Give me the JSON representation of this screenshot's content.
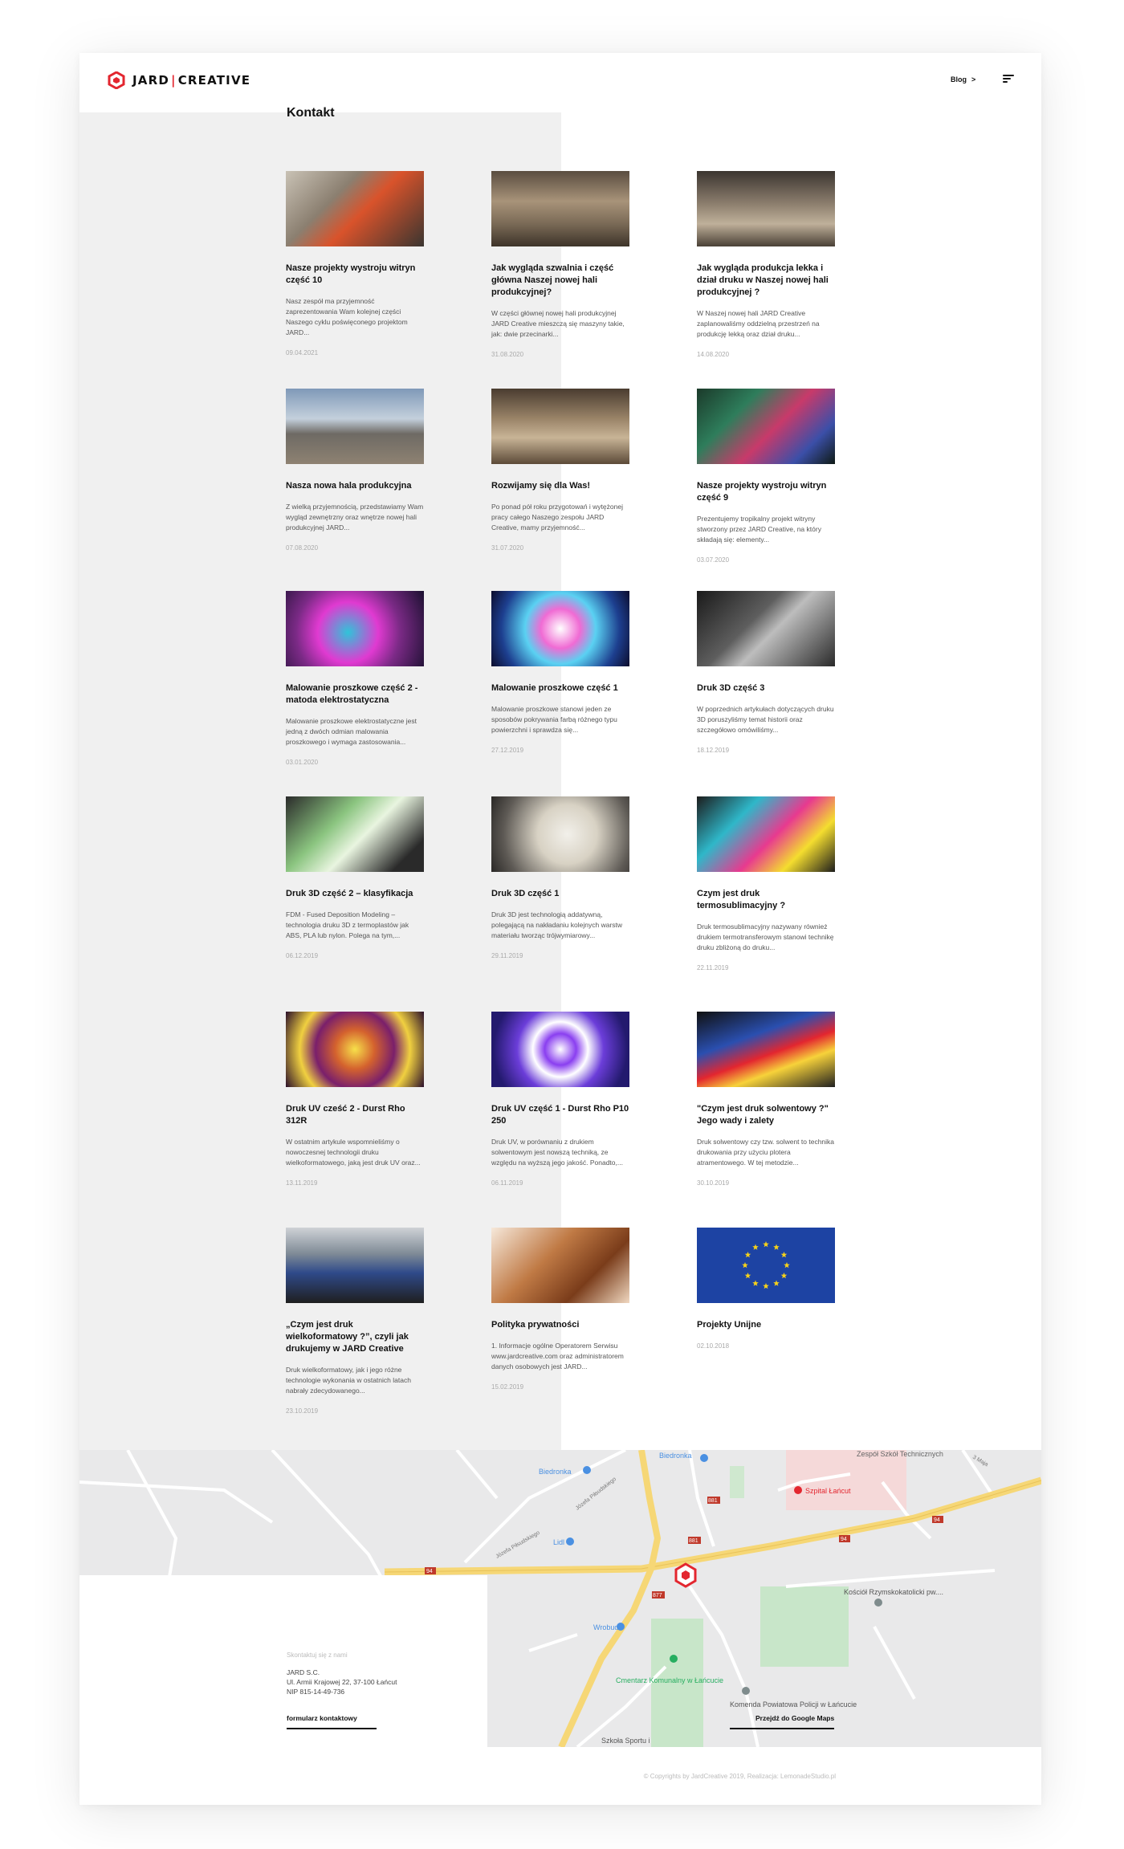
{
  "header": {
    "logo_left": "JARD",
    "logo_sep": "|",
    "logo_right": "CREATIVE",
    "nav_blog": "Blog",
    "nav_chevron": ">"
  },
  "posts": [
    {
      "title": "Nasze projekty wystroju witryn część 10",
      "excerpt": "Nasz zespół ma przyjemność zaprezentowania Wam kolejnej części Naszego cyklu poświęconego projektom JARD...",
      "date": "09.04.2021"
    },
    {
      "title": "Jak wygląda szwalnia i część główna Naszej nowej hali produkcyjnej?",
      "excerpt": "W części głównej nowej hali produkcyjnej JARD Creative mieszczą się maszyny takie, jak: dwie przecinarki...",
      "date": "31.08.2020"
    },
    {
      "title": "Jak wygląda produkcja lekka i dział druku w Naszej nowej hali produkcyjnej ?",
      "excerpt": "W Naszej nowej hali JARD Creative zaplanowaliśmy oddzielną przestrzeń na produkcję lekką oraz dział druku...",
      "date": "14.08.2020"
    },
    {
      "title": "Nasza nowa hala produkcyjna",
      "excerpt": "Z wielką przyjemnością, przedstawiamy Wam wygląd zewnętrzny oraz wnętrze nowej hali produkcyjnej JARD...",
      "date": "07.08.2020"
    },
    {
      "title": "Rozwijamy się dla Was!",
      "excerpt": "Po ponad pół roku przygotowań i wytężonej pracy całego Naszego zespołu JARD Creative, mamy przyjemność...",
      "date": "31.07.2020"
    },
    {
      "title": "Nasze projekty wystroju witryn część 9",
      "excerpt": "Prezentujemy tropikalny projekt witryny stworzony przez JARD Creative, na który składają się: elementy...",
      "date": "03.07.2020"
    },
    {
      "title": "Malowanie proszkowe część 2 - matoda elektrostatyczna",
      "excerpt": "Malowanie proszkowe elektrostatyczne jest jedną z dwóch odmian malowania proszkowego i wymaga zastosowania...",
      "date": "03.01.2020"
    },
    {
      "title": "Malowanie proszkowe część 1",
      "excerpt": "Malowanie proszkowe stanowi jeden ze sposobów pokrywania farbą różnego typu powierzchni i sprawdza się...",
      "date": "27.12.2019"
    },
    {
      "title": "Druk 3D część 3",
      "excerpt": "W poprzednich artykułach dotyczących druku 3D poruszyliśmy temat historii oraz szczegółowo omówiliśmy...",
      "date": "18.12.2019"
    },
    {
      "title": "Druk 3D część 2 – klasyfikacja",
      "excerpt": "FDM - Fused Deposition Modeling – technologia druku 3D z termoplastów jak ABS, PLA lub nylon. Polega na tym,...",
      "date": "06.12.2019"
    },
    {
      "title": "Druk 3D część 1",
      "excerpt": "Druk 3D jest technologią addatywną, polegającą na nakładaniu kolejnych warstw materiału tworząc trójwymiarowy...",
      "date": "29.11.2019"
    },
    {
      "title": "Czym jest druk termosublimacyjny ?",
      "excerpt": "Druk termosublimacyjny nazywany również drukiem termotransferowym stanowi technikę druku zbliżoną do druku...",
      "date": "22.11.2019"
    },
    {
      "title": "Druk UV cześć 2 - Durst Rho 312R",
      "excerpt": "W ostatnim artykule wspomnieliśmy o nowoczesnej technologii druku wielkoformatowego, jaką jest druk UV oraz...",
      "date": "13.11.2019"
    },
    {
      "title": "Druk UV część 1 - Durst Rho P10 250",
      "excerpt": "Druk UV, w porównaniu z drukiem solwentowym jest nowszą techniką, ze względu na wyższą jego jakość. Ponadto,...",
      "date": "06.11.2019"
    },
    {
      "title": "\"Czym jest druk solwentowy ?\" Jego wady i zalety",
      "excerpt": "Druk solwentowy czy tzw. solwent to technika drukowania przy użyciu plotera atramentowego. W tej metodzie...",
      "date": "30.10.2019"
    },
    {
      "title": "„Czym jest druk wielkoformatowy ?”, czyli jak drukujemy w JARD Creative",
      "excerpt": "Druk wielkoformatowy, jak i jego różne technologie wykonania w ostatnich latach nabrały zdecydowanego...",
      "date": "23.10.2019"
    },
    {
      "title": "Polityka prywatności",
      "excerpt": "1. Informacje ogólne Operatorem Serwisu www.jardcreative.com oraz administratorem danych osobowych jest JARD...",
      "date": "15.02.2019"
    },
    {
      "title": "Projekty Unijne",
      "excerpt": "",
      "date": "02.10.2018"
    }
  ],
  "map": {
    "labels": {
      "biedronka1": "Biedronka",
      "biedronka2": "Biedronka",
      "zespol": "Zespół Szkół Technicznych",
      "szpital": "Szpital Łańcut",
      "lidl": "Lidl",
      "wrobud": "Wrobud",
      "cmentarz": "Cmentarz Komunalny w Łańcucie",
      "komenda": "Komenda Powiatowa Policji w Łańcucie",
      "kosciol": "Kościół Rzymskokatolicki pw....",
      "szkola": "Szkoła Sportu i",
      "pilsudskiego": "Józefa Piłsudskiego",
      "pilsudskiego2": "Józefa Piłsudskiego",
      "maja": "3 Maja",
      "r94a": "94",
      "r94b": "94",
      "r94c": "94",
      "r881a": "881",
      "r881b": "881",
      "r877": "877"
    }
  },
  "contact": {
    "title": "Kontakt",
    "subtitle": "Skontaktuj się z nami",
    "line1": "JARD S.C.",
    "line2": "Ul. Armii Krajowej 22, 37-100 Łańcut",
    "line3": "NIP 815-14-49-736",
    "form_link": "formularz kontaktowy",
    "maps_link": "Przejdź do Google Maps"
  },
  "footer": {
    "copyright": "© Copyrights by JardCreative 2019, Realizacja: LemonadeStudio.pl"
  },
  "colors": {
    "brand_red": "#e3262f",
    "panel_gray": "#f0f0f0",
    "map_bg": "#e9e9ea",
    "road_yellow": "#f6d776"
  }
}
